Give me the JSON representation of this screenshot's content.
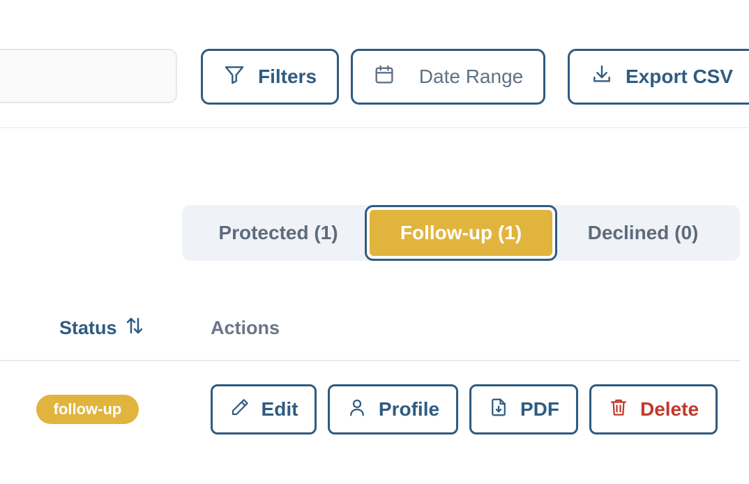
{
  "toolbar": {
    "search": {
      "value": ""
    },
    "filters_label": "Filters",
    "date_range_label": "Date Range",
    "export_label": "Export CSV"
  },
  "tabs": [
    {
      "label": "Protected (1)",
      "active": false
    },
    {
      "label": "Follow-up (1)",
      "active": true
    },
    {
      "label": "Declined (0)",
      "active": false
    }
  ],
  "table": {
    "columns": {
      "status": "Status",
      "actions": "Actions"
    },
    "rows": [
      {
        "status_badge": "follow-up",
        "actions": {
          "edit": "Edit",
          "profile": "Profile",
          "pdf": "PDF",
          "delete": "Delete"
        }
      }
    ]
  },
  "colors": {
    "primary": "#2f5b80",
    "accent": "#e1b43e",
    "danger": "#c0392b",
    "tab_bg": "#eff3f8",
    "muted_text": "#5f6b7b"
  },
  "icons": {
    "filters": "filter-funnel-icon",
    "date_range": "calendar-icon",
    "export": "download-icon",
    "sort": "sort-arrows-icon",
    "edit": "pencil-icon",
    "profile": "user-icon",
    "pdf": "file-download-icon",
    "delete": "trash-icon"
  }
}
